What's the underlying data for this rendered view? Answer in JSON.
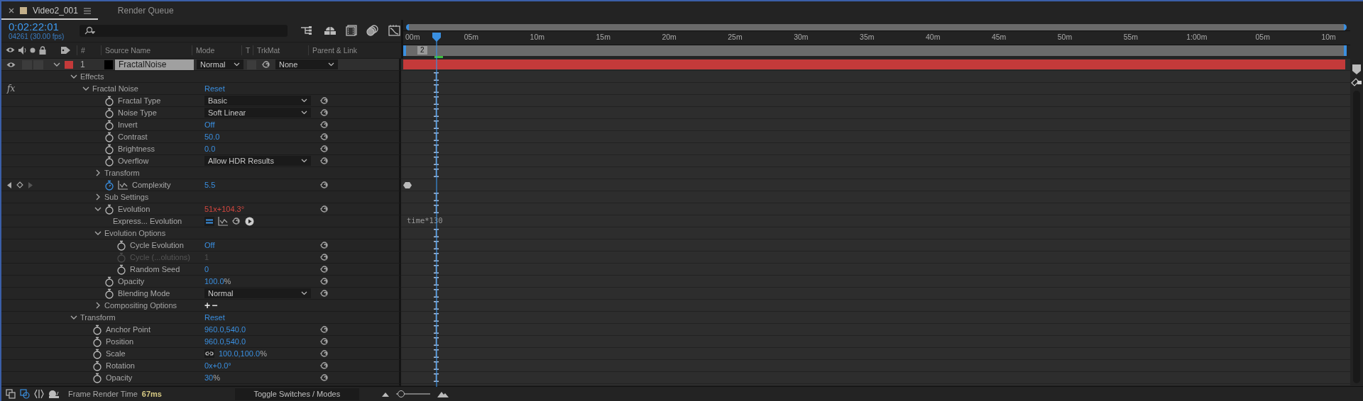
{
  "tabs": [
    {
      "label": "Video2_001",
      "selected": true,
      "color": "#c4b08a"
    },
    {
      "label": "Render Queue",
      "selected": false
    }
  ],
  "timecode": "0:02:22:01",
  "frame_info": "04261 (30.00 fps)",
  "columns": [
    "#",
    "Source Name",
    "Mode",
    "T",
    "TrkMat",
    "Parent & Link"
  ],
  "layer": {
    "number": "1",
    "name": "FractalNoise",
    "color": "#c43a3a",
    "visible": true,
    "selected": true,
    "expanded": true,
    "mode": "Normal",
    "parent": "None",
    "children": [
      {
        "kind": "group",
        "label": "Effects",
        "expanded": true,
        "children": [
          {
            "kind": "group",
            "label": "Fractal Noise",
            "badge": "fx",
            "value": "Reset",
            "expanded": true,
            "children": [
              {
                "kind": "dropdown",
                "label": "Fractal Type",
                "value": "Basic"
              },
              {
                "kind": "dropdown",
                "label": "Noise Type",
                "value": "Soft Linear"
              },
              {
                "kind": "value",
                "label": "Invert",
                "value": "Off"
              },
              {
                "kind": "value",
                "label": "Contrast",
                "value": "50.0"
              },
              {
                "kind": "value",
                "label": "Brightness",
                "value": "0.0"
              },
              {
                "kind": "dropdown",
                "label": "Overflow",
                "value": "Allow HDR Results"
              },
              {
                "kind": "group",
                "label": "Transform",
                "expanded": false
              },
              {
                "kind": "value",
                "label": "Complexity",
                "value": "5.5",
                "animated": true
              },
              {
                "kind": "group",
                "label": "Sub Settings",
                "expanded": false
              },
              {
                "kind": "value",
                "label": "Evolution",
                "value": "51x+104.3°",
                "expression": true,
                "expanded": true,
                "children": [
                  {
                    "kind": "expression",
                    "label": "Express... Evolution",
                    "code": "time*130"
                  }
                ]
              },
              {
                "kind": "group",
                "label": "Evolution Options",
                "expanded": true,
                "children": [
                  {
                    "kind": "value",
                    "label": "Cycle Evolution",
                    "value": "Off"
                  },
                  {
                    "kind": "value",
                    "label": "Cycle (...olutions)",
                    "value": "1",
                    "disabled": true
                  },
                  {
                    "kind": "value",
                    "label": "Random Seed",
                    "value": "0"
                  }
                ]
              },
              {
                "kind": "value",
                "label": "Opacity",
                "value": "100.0",
                "unit": "%"
              },
              {
                "kind": "dropdown",
                "label": "Blending Mode",
                "value": "Normal"
              },
              {
                "kind": "group",
                "label": "Compositing Options",
                "expanded": false,
                "buttons": [
                  "+",
                  "−"
                ]
              }
            ]
          }
        ]
      },
      {
        "kind": "group",
        "label": "Transform",
        "value": "Reset",
        "expanded": true,
        "children": [
          {
            "kind": "value",
            "label": "Anchor Point",
            "value": "960.0,540.0"
          },
          {
            "kind": "value",
            "label": "Position",
            "value": "960.0,540.0"
          },
          {
            "kind": "value",
            "label": "Scale",
            "value": "100.0,100.0",
            "unit": "%",
            "linked": true
          },
          {
            "kind": "value",
            "label": "Rotation",
            "value": "0x+0.0°"
          },
          {
            "kind": "value",
            "label": "Opacity",
            "value": "30",
            "unit": "%"
          }
        ]
      }
    ]
  },
  "ruler": [
    "00m",
    "05m",
    "10m",
    "15m",
    "20m",
    "25m",
    "30m",
    "35m",
    "40m",
    "45m",
    "50m",
    "55m",
    "1:00m",
    "05m",
    "10m"
  ],
  "marker": "2",
  "status_bar": {
    "label": "Frame Render Time",
    "value": "67ms",
    "toggle": "Toggle Switches / Modes",
    "zoom": {
      "level": 0.15
    }
  }
}
